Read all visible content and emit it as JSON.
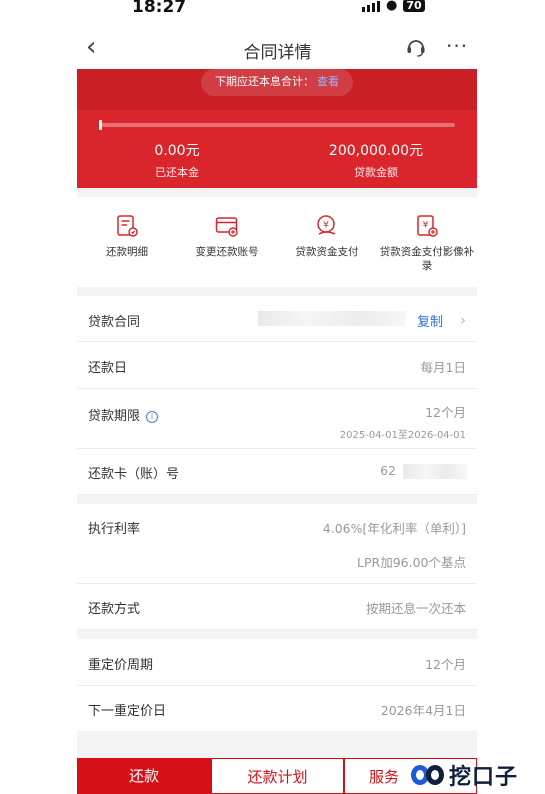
{
  "status_bar": {
    "time": "18:27",
    "battery": "70"
  },
  "nav": {
    "back": "‹",
    "title": "合同详情",
    "more": "···"
  },
  "summary": {
    "next_period_label": "下期应还本息合计：",
    "next_period_value": "查看",
    "repaid_progress_fraction": 0.0,
    "repaid_principal_value": "0.00元",
    "repaid_principal_label": "已还本金",
    "loan_amount_value": "200,000.00元",
    "loan_amount_label": "贷款金额"
  },
  "functions": [
    {
      "label": "还款明细",
      "icon": "repayment-detail-icon"
    },
    {
      "label": "变更还款账号",
      "icon": "change-account-icon"
    },
    {
      "label": "贷款资金支付",
      "icon": "fund-payment-icon"
    },
    {
      "label": "贷款资金支付影像补录",
      "icon": "image-supplement-icon"
    }
  ],
  "rows": {
    "contract": {
      "label": "贷款合同",
      "copy": "复制",
      "chevron": "›"
    },
    "repay_day": {
      "label": "还款日",
      "value": "每月1日"
    },
    "term": {
      "label": "贷款期限",
      "info": "i",
      "value": "12个月",
      "sub": "2025-04-01至2026-04-01"
    },
    "card": {
      "label": "还款卡（账）号",
      "value": "62"
    },
    "rate": {
      "label": "执行利率",
      "value": "4.06%[年化利率（单利）]",
      "sub": "LPR加96.00个基点"
    },
    "method": {
      "label": "还款方式",
      "value": "按期还息一次还本"
    },
    "reprice_cycle": {
      "label": "重定价周期",
      "value": "12个月"
    },
    "next_reprice": {
      "label": "下一重定价日",
      "value": "2026年4月1日"
    }
  },
  "bottom_bar": {
    "repay": "还款",
    "plan": "还款计划",
    "service": "服务"
  },
  "watermark": {
    "text": "挖口子"
  },
  "colors": {
    "brand_red": "#d9252b",
    "button_red": "#d40f16",
    "link_blue": "#2f6fd8"
  }
}
